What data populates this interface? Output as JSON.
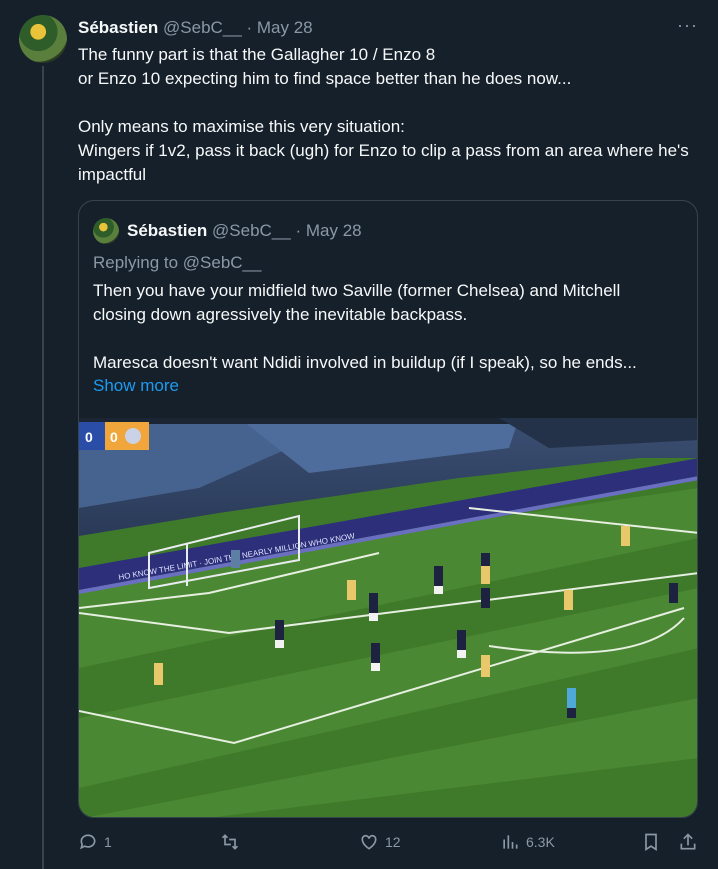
{
  "tweet": {
    "author_name": "Sébastien",
    "author_handle": "@SebC__",
    "separator": "·",
    "date": "May 28",
    "more_label": "···",
    "lines": [
      "The funny part is that the Gallagher 10 / Enzo 8",
      "or Enzo 10 expecting him to find space better than he does now...",
      "Only means to maximise this very situation:",
      "Wingers if 1v2, pass it back (ugh) for Enzo to clip a pass from an area where he's impactful"
    ]
  },
  "quote": {
    "author_name": "Sébastien",
    "author_handle": "@SebC__",
    "separator": "·",
    "date": "May 28",
    "replying_to": "Replying to @SebC__",
    "lines": [
      "Then you have your midfield two Saville (former Chelsea) and Mitchell",
      "closing down agressively the inevitable backpass.",
      "Maresca doesn't want Ndidi involved in buildup (if I speak), so he ends..."
    ],
    "show_more": "Show more",
    "image": {
      "description_icon": "football-match-photo",
      "scoreboard": "0 0"
    }
  },
  "actions": {
    "reply_count": "1",
    "retweet_count": "",
    "like_count": "12",
    "views_count": "6.3K"
  },
  "colors": {
    "background": "#15202b",
    "text": "#f7f9f9",
    "muted": "#8b98a5",
    "accent": "#1d9bf0",
    "border": "#38444d"
  }
}
